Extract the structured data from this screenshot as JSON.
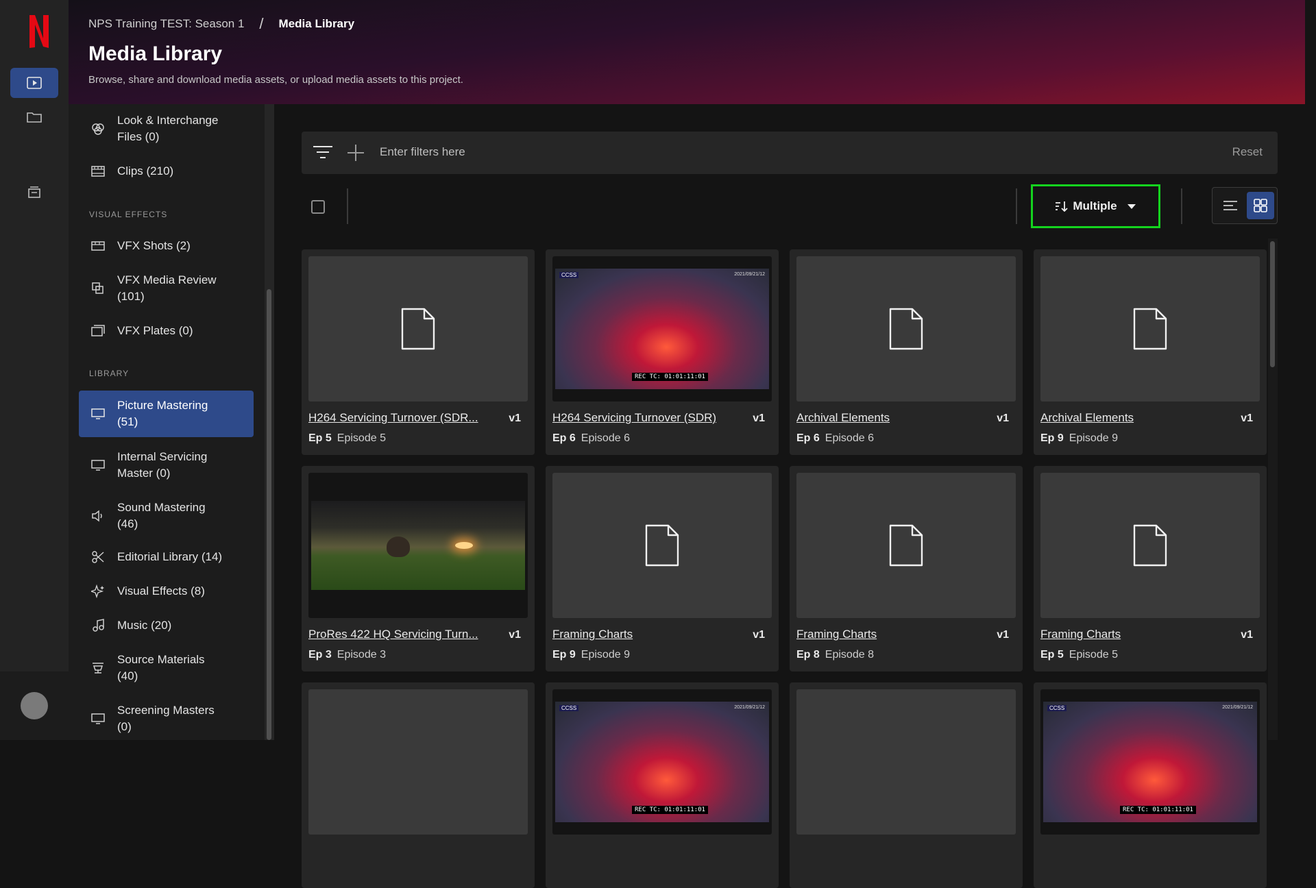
{
  "breadcrumb": {
    "project": "NPS Training TEST: Season 1",
    "separator": "/",
    "current": "Media Library"
  },
  "page": {
    "title": "Media Library",
    "subtitle": "Browse, share and download media assets, or upload media assets to this project."
  },
  "sidebar": {
    "items_top": [
      {
        "label": "Look & Interchange Files (0)",
        "icon": "look-icon"
      },
      {
        "label": "Clips (210)",
        "icon": "clips-icon"
      }
    ],
    "sections": [
      {
        "heading": "VISUAL EFFECTS",
        "items": [
          {
            "label": "VFX Shots (2)",
            "icon": "vfx-shots-icon"
          },
          {
            "label": "VFX Media Review (101)",
            "icon": "vfx-review-icon"
          },
          {
            "label": "VFX Plates (0)",
            "icon": "vfx-plates-icon"
          }
        ]
      },
      {
        "heading": "LIBRARY",
        "items": [
          {
            "label": "Picture Mastering (51)",
            "icon": "monitor-icon",
            "active": true
          },
          {
            "label": "Internal Servicing Master (0)",
            "icon": "monitor-icon"
          },
          {
            "label": "Sound Mastering (46)",
            "icon": "speaker-icon"
          },
          {
            "label": "Editorial Library (14)",
            "icon": "scissors-icon"
          },
          {
            "label": "Visual Effects (8)",
            "icon": "sparkle-icon"
          },
          {
            "label": "Music (20)",
            "icon": "music-icon"
          },
          {
            "label": "Source Materials (40)",
            "icon": "source-icon"
          },
          {
            "label": "Screening Masters (0)",
            "icon": "monitor-icon"
          }
        ]
      }
    ]
  },
  "filters": {
    "placeholder": "Enter filters here",
    "reset_label": "Reset"
  },
  "sort": {
    "label": "Multiple"
  },
  "cards": [
    {
      "title": "H264 Servicing Turnover (SDR...",
      "version": "v1",
      "ep_code": "Ep 5",
      "ep_name": "Episode 5",
      "thumb": "file"
    },
    {
      "title": "H264 Servicing Turnover (SDR)",
      "version": "v1",
      "ep_code": "Ep 6",
      "ep_name": "Episode 6",
      "thumb": "fire"
    },
    {
      "title": "Archival Elements",
      "version": "v1",
      "ep_code": "Ep 6",
      "ep_name": "Episode 6",
      "thumb": "file"
    },
    {
      "title": "Archival Elements",
      "version": "v1",
      "ep_code": "Ep 9",
      "ep_name": "Episode 9",
      "thumb": "file"
    },
    {
      "title": "ProRes 422 HQ Servicing Turn...",
      "version": "v1",
      "ep_code": "Ep 3",
      "ep_name": "Episode 3",
      "thumb": "field"
    },
    {
      "title": "Framing Charts",
      "version": "v1",
      "ep_code": "Ep 9",
      "ep_name": "Episode 9",
      "thumb": "file"
    },
    {
      "title": "Framing Charts",
      "version": "v1",
      "ep_code": "Ep 8",
      "ep_name": "Episode 8",
      "thumb": "file"
    },
    {
      "title": "Framing Charts",
      "version": "v1",
      "ep_code": "Ep 5",
      "ep_name": "Episode 5",
      "thumb": "file"
    },
    {
      "title": "",
      "version": "",
      "ep_code": "",
      "ep_name": "",
      "thumb": "blank"
    },
    {
      "title": "",
      "version": "",
      "ep_code": "",
      "ep_name": "",
      "thumb": "fire"
    },
    {
      "title": "",
      "version": "",
      "ep_code": "",
      "ep_name": "",
      "thumb": "blank"
    },
    {
      "title": "",
      "version": "",
      "ep_code": "",
      "ep_name": "",
      "thumb": "fire"
    }
  ],
  "thumb_overlay": {
    "tc": "REC TC: 01:01:11:01",
    "tl": "CCSS",
    "tr": "2021/09/21/12"
  },
  "colors": {
    "accent": "#2e4a8a",
    "highlight": "#14d31e",
    "brand": "#e50914"
  }
}
